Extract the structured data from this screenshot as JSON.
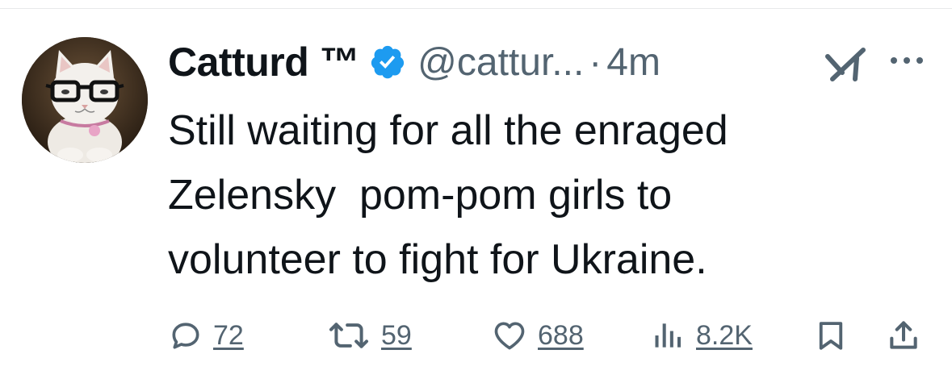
{
  "tweet": {
    "display_name": "Catturd ™",
    "handle": "@cattur...",
    "separator": "·",
    "time": "4m",
    "text": "Still waiting for all the enraged\nZelensky  pom-pom girls to\nvolunteer to fight for Ukraine.",
    "verified_color": "#1d9bf0",
    "avatar_icon": "cat-with-glasses-avatar",
    "header_icons": [
      "grok-icon",
      "more-icon"
    ]
  },
  "actions": {
    "replies": "72",
    "reposts": "59",
    "likes": "688",
    "views": "8.2K",
    "icons": [
      "reply-icon",
      "repost-icon",
      "like-icon",
      "views-icon",
      "bookmark-icon",
      "share-icon"
    ]
  },
  "colors": {
    "text": "#0f1419",
    "secondary": "#536471",
    "accent": "#1d9bf0"
  }
}
